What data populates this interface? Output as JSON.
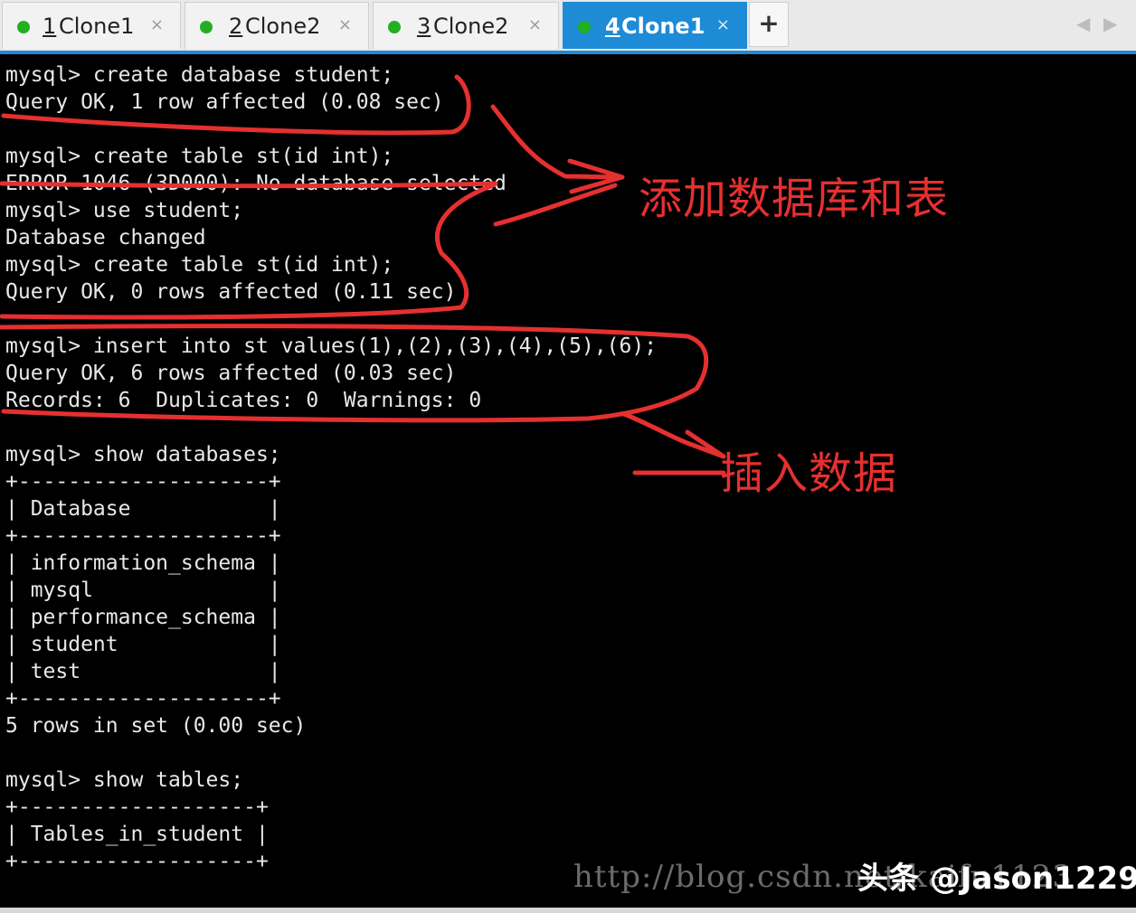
{
  "tabs": [
    {
      "num": "1",
      "name": "Clone1",
      "close": "×"
    },
    {
      "num": "2",
      "name": "Clone2",
      "close": "×"
    },
    {
      "num": "3",
      "name": "Clone2",
      "close": "×"
    },
    {
      "num": "4",
      "name": "Clone1",
      "close": "×",
      "active": true
    }
  ],
  "add_tab": "+",
  "nav": {
    "prev": "◀",
    "next": "▶"
  },
  "terminal_lines": [
    "mysql> create database student;",
    "Query OK, 1 row affected (0.08 sec)",
    "",
    "mysql> create table st(id int);",
    "ERROR 1046 (3D000): No database selected",
    "mysql> use student;",
    "Database changed",
    "mysql> create table st(id int);",
    "Query OK, 0 rows affected (0.11 sec)",
    "",
    "mysql> insert into st values(1),(2),(3),(4),(5),(6);",
    "Query OK, 6 rows affected (0.03 sec)",
    "Records: 6  Duplicates: 0  Warnings: 0",
    "",
    "mysql> show databases;",
    "+--------------------+",
    "| Database           |",
    "+--------------------+",
    "| information_schema |",
    "| mysql              |",
    "| performance_schema |",
    "| student            |",
    "| test               |",
    "+--------------------+",
    "5 rows in set (0.00 sec)",
    "",
    "mysql> show tables;",
    "+-------------------+",
    "| Tables_in_student |",
    "+-------------------+"
  ],
  "annotations": {
    "add_db_table": "添加数据库和表",
    "insert_data": "插入数据",
    "color": "#e53030"
  },
  "watermark": {
    "url": "http://blog.csdn.net/kaifu1123",
    "brand": "头条 @Jason1229"
  },
  "colors": {
    "accent": "#1e8bd6",
    "status_dot": "#22b022",
    "terminal_bg": "#000000"
  }
}
